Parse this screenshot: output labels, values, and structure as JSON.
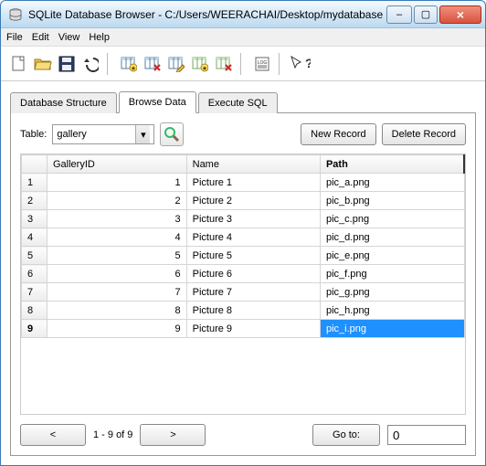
{
  "titlebar": {
    "app_name": "SQLite Database Browser",
    "file_path": "C:/Users/WEERACHAI/Desktop/mydatabase"
  },
  "window_controls": {
    "minimize": "–",
    "maximize": "▢",
    "close": "×"
  },
  "menu": {
    "file": "File",
    "edit": "Edit",
    "view": "View",
    "help": "Help"
  },
  "toolbar_icons": {
    "new": "new-file-icon",
    "open": "open-folder-icon",
    "save": "save-disk-icon",
    "undo": "undo-icon",
    "t1": "create-table-icon",
    "t2": "delete-table-icon",
    "t3": "modify-table-icon",
    "t4": "create-index-icon",
    "t5": "delete-index-icon",
    "log": "log-icon",
    "help": "whatsthis-icon"
  },
  "tabs": {
    "structure": "Database Structure",
    "browse": "Browse Data",
    "execute": "Execute SQL"
  },
  "browse": {
    "table_label": "Table:",
    "selected_table": "gallery",
    "new_record": "New Record",
    "delete_record": "Delete Record",
    "columns": {
      "id": "GalleryID",
      "name": "Name",
      "path": "Path"
    },
    "rows": [
      {
        "row": "1",
        "id": "1",
        "name": "Picture 1",
        "path": "pic_a.png"
      },
      {
        "row": "2",
        "id": "2",
        "name": "Picture 2",
        "path": "pic_b.png"
      },
      {
        "row": "3",
        "id": "3",
        "name": "Picture 3",
        "path": "pic_c.png"
      },
      {
        "row": "4",
        "id": "4",
        "name": "Picture 4",
        "path": "pic_d.png"
      },
      {
        "row": "5",
        "id": "5",
        "name": "Picture 5",
        "path": "pic_e.png"
      },
      {
        "row": "6",
        "id": "6",
        "name": "Picture 6",
        "path": "pic_f.png"
      },
      {
        "row": "7",
        "id": "7",
        "name": "Picture 7",
        "path": "pic_g.png"
      },
      {
        "row": "8",
        "id": "8",
        "name": "Picture 8",
        "path": "pic_h.png"
      },
      {
        "row": "9",
        "id": "9",
        "name": "Picture 9",
        "path": "pic_i.png"
      }
    ],
    "selected_row": 8,
    "selected_col": "path",
    "footer": {
      "prev": "<",
      "next": ">",
      "range": "1 - 9 of 9",
      "goto": "Go to:",
      "goto_value": "0"
    }
  }
}
